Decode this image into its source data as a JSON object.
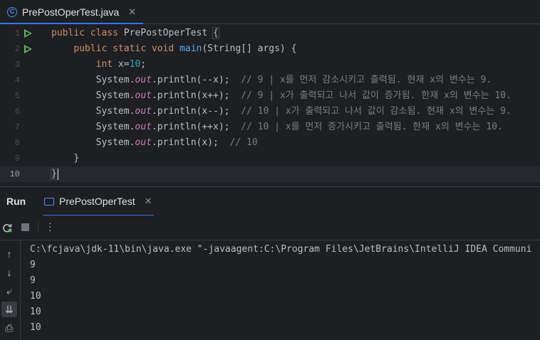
{
  "editor_tab": {
    "label": "PrePostOperTest.java",
    "icon": "java-class-icon"
  },
  "editor": {
    "lines": [
      {
        "num": "1"
      },
      {
        "num": "2"
      },
      {
        "num": "3"
      },
      {
        "num": "4"
      },
      {
        "num": "5"
      },
      {
        "num": "6"
      },
      {
        "num": "7"
      },
      {
        "num": "8"
      },
      {
        "num": "9"
      },
      {
        "num": "10"
      }
    ],
    "tokens": {
      "l1_public": "public",
      "l1_class": "class",
      "l1_name": "PrePostOperTest",
      "l1_brace": "{",
      "l2_public": "public",
      "l2_static": "static",
      "l2_void": "void",
      "l2_main": "main",
      "l2_args": "(String[] args) {",
      "l3_int": "int",
      "l3_x": " x=",
      "l3_num": "10",
      "l3_end": ";",
      "sys": "System.",
      "out": "out",
      "println": ".println(",
      "l4_arg": "--x);",
      "l4_cm": "// 9 | x를 먼저 감소시키고 출력됨. 현재 x의 변수는 9.",
      "l5_arg": "x++);",
      "l5_cm": "// 9 | x가 출력되고 나서 값이 증가됨. 한재 x의 변수는 10.",
      "l6_arg": "x--);",
      "l6_cm": "// 10 | x가 출력되고 나서 값이 감소됨. 현재 x의 변수는 9.",
      "l7_arg": "++x);",
      "l7_cm": "// 10 | x를 먼저 증가시키고 출력됨. 한재 x의 변수는 10.",
      "l8_arg": "x);",
      "l8_cm": "// 10",
      "l9_brace": "}",
      "l10_brace": "}"
    }
  },
  "run_panel": {
    "title": "Run",
    "tab_label": "PrePostOperTest",
    "console": [
      "C:\\fcjava\\jdk-11\\bin\\java.exe \"-javaagent:C:\\Program Files\\JetBrains\\IntelliJ IDEA Communi",
      "9",
      "9",
      "10",
      "10",
      "10"
    ]
  },
  "colors": {
    "accent": "#3574f0",
    "run_green": "#5fb865",
    "keyword": "#cf8e6d",
    "function": "#56a8f5",
    "number": "#2aacb8",
    "static_field": "#c77dbb",
    "comment": "#7a7e85"
  }
}
